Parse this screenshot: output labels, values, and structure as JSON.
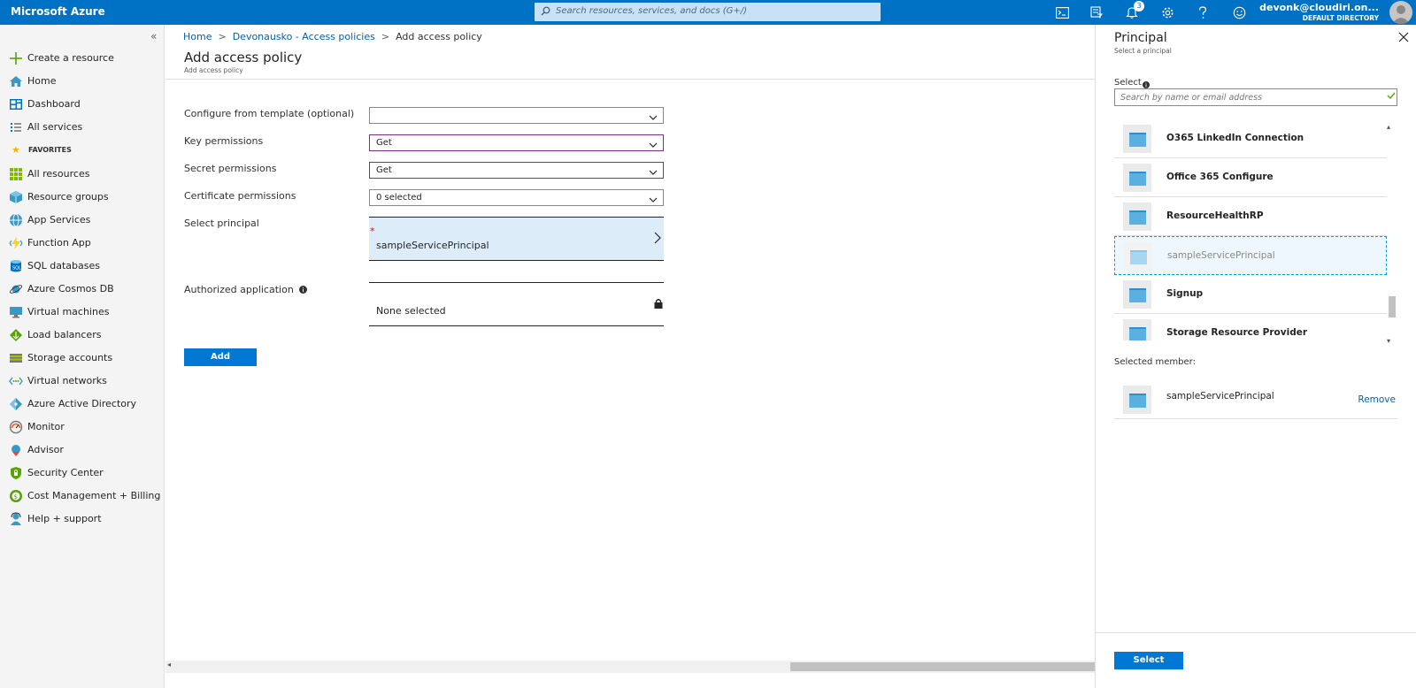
{
  "topbar": {
    "brand": "Microsoft Azure",
    "search_placeholder": "Search resources, services, and docs (G+/)",
    "notification_count": "3",
    "user_name": "devonk@cloudiri.on...",
    "user_directory": "DEFAULT DIRECTORY",
    "icons": [
      "cloud-shell-icon",
      "directory-filter-icon",
      "notifications-icon",
      "settings-icon",
      "help-icon",
      "feedback-icon"
    ]
  },
  "sidebar": {
    "collapse_glyph": "«",
    "favorites_label": "FAVORITES",
    "top_items": [
      {
        "label": "Create a resource",
        "icon": "plus-icon"
      },
      {
        "label": "Home",
        "icon": "home-icon"
      },
      {
        "label": "Dashboard",
        "icon": "dashboard-icon"
      },
      {
        "label": "All services",
        "icon": "list-icon"
      }
    ],
    "favorites": [
      {
        "label": "All resources",
        "icon": "grid-icon"
      },
      {
        "label": "Resource groups",
        "icon": "cube-icon"
      },
      {
        "label": "App Services",
        "icon": "globe-icon"
      },
      {
        "label": "Function App",
        "icon": "bolt-icon"
      },
      {
        "label": "SQL databases",
        "icon": "database-icon"
      },
      {
        "label": "Azure Cosmos DB",
        "icon": "planet-icon"
      },
      {
        "label": "Virtual machines",
        "icon": "monitor-icon"
      },
      {
        "label": "Load balancers",
        "icon": "diamond-icon"
      },
      {
        "label": "Storage accounts",
        "icon": "storage-icon"
      },
      {
        "label": "Virtual networks",
        "icon": "network-icon"
      },
      {
        "label": "Azure Active Directory",
        "icon": "directory-icon"
      },
      {
        "label": "Monitor",
        "icon": "gauge-icon"
      },
      {
        "label": "Advisor",
        "icon": "advisor-icon"
      },
      {
        "label": "Security Center",
        "icon": "shield-icon"
      },
      {
        "label": "Cost Management + Billing",
        "icon": "billing-icon"
      },
      {
        "label": "Help + support",
        "icon": "support-icon"
      }
    ]
  },
  "breadcrumb": {
    "home": "Home",
    "parent": "Devonausko - Access policies",
    "current": "Add access policy",
    "separator": ">"
  },
  "page": {
    "title": "Add access policy",
    "subtitle": "Add access policy"
  },
  "form": {
    "template_label": "Configure from template (optional)",
    "template_value": "",
    "key_label": "Key permissions",
    "key_value": "Get",
    "secret_label": "Secret permissions",
    "secret_value": "Get",
    "cert_label": "Certificate permissions",
    "cert_value": "0 selected",
    "principal_label": "Select principal",
    "principal_required": "*",
    "principal_value": "sampleServicePrincipal",
    "authapp_label": "Authorized application",
    "authapp_value": "None selected",
    "add_button": "Add"
  },
  "blade": {
    "title": "Principal",
    "subtitle": "Select a principal",
    "select_label": "Select",
    "search_placeholder": "Search by name or email address",
    "list": [
      {
        "name": "O365 LinkedIn Connection",
        "selected": false
      },
      {
        "name": "Office 365 Configure",
        "selected": false
      },
      {
        "name": "ResourceHealthRP",
        "selected": false
      },
      {
        "name": "sampleServicePrincipal",
        "selected": true
      },
      {
        "name": "Signup",
        "selected": false
      },
      {
        "name": "Storage Resource Provider",
        "selected": false
      }
    ],
    "selected_member_label": "Selected member:",
    "selected_member": "sampleServicePrincipal",
    "remove_link": "Remove",
    "select_button": "Select"
  },
  "colors": {
    "brand_blue": "#0072c6",
    "button_blue": "#0078d4",
    "link_blue": "#0062ad",
    "dirty_border": "#7e2d8c",
    "principal_bg": "#dcedf9"
  }
}
